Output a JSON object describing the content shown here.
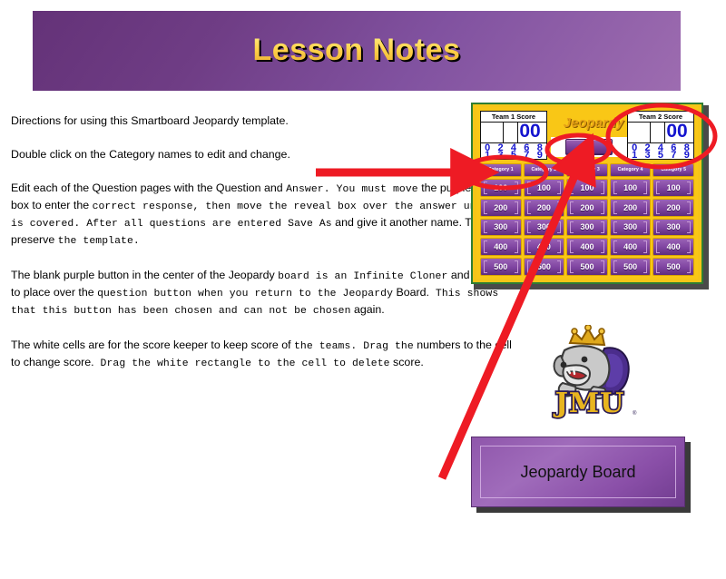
{
  "slide": {
    "title": "Lesson Notes"
  },
  "notes": {
    "paragraphs": [
      {
        "id": "directions",
        "runs": [
          {
            "text": "Directions for using this Smartboard Jeopardy template.",
            "style": "sans"
          }
        ]
      },
      {
        "id": "double-click",
        "runs": [
          {
            "text": "Double click on the Category names to edit and change.",
            "style": "sans"
          }
        ]
      },
      {
        "id": "edit-questions",
        "runs": [
          {
            "text": "Edit each of the Question pages with the Question and ",
            "style": "sans"
          },
          {
            "text": "Answer.   You must move",
            "style": "mono"
          },
          {
            "text": " the purple reveal box to enter the ",
            "style": "sans"
          },
          {
            "text": " correct response, then move the reveal box over the ",
            "style": "mono"
          },
          {
            "text": " answer until it is covered. After all questions are entered ",
            "style": "mono"
          },
          {
            "text": " Save As",
            "style": "mono"
          },
          {
            "text": " and give it another name. This helps preserve ",
            "style": "sans"
          },
          {
            "text": " the template.",
            "style": "mono"
          }
        ]
      },
      {
        "id": "infinite-cloner",
        "runs": [
          {
            "text": "The blank purple button in the center of the Jeopardy ",
            "style": "sans"
          },
          {
            "text": "  board is an Infinite Cloner",
            "style": "mono"
          },
          {
            "text": " and is used to place over the ",
            "style": "sans"
          },
          {
            "text": " question button when you return to the Jeopardy",
            "style": "mono"
          },
          {
            "text": " Board.",
            "style": "sans"
          },
          {
            "text": "  This shows that this button has been chosen and can not ",
            "style": "mono"
          },
          {
            "text": "  be chosen",
            "style": "mono"
          },
          {
            "text": " again.",
            "style": "sans"
          }
        ]
      },
      {
        "id": "white-cells",
        "runs": [
          {
            "text": "The white cells are for the score keeper to keep score of ",
            "style": "sans"
          },
          {
            "text": "  the teams.   Drag the",
            "style": "mono"
          },
          {
            "text": " numbers to the cell to change score.",
            "style": "sans"
          },
          {
            "text": "   Drag the white rectangle to the cell to delete",
            "style": "mono"
          },
          {
            "text": " score.",
            "style": "sans"
          }
        ]
      }
    ]
  },
  "board": {
    "game_title": "Jeopardy",
    "teams": [
      {
        "label": "Team 1 Score",
        "score": "00"
      },
      {
        "label": "Team 2 Score",
        "score": "00"
      }
    ],
    "digit_row_top": [
      "0",
      "2",
      "4",
      "6",
      "8"
    ],
    "digit_row_bottom": [
      "1",
      "3",
      "5",
      "7",
      "9"
    ],
    "cloner_button_label": "",
    "categories": [
      "Category 1",
      "Category 2",
      "Category 3",
      "Category 4",
      "Category 5"
    ],
    "values": [
      "100",
      "200",
      "300",
      "400",
      "500"
    ],
    "colors": {
      "frame": "#f9c716",
      "tile": "#7e43a0",
      "tile_border": "#d9a400",
      "score_text": "#1414cf",
      "title_text": "#e8a317"
    }
  },
  "logo": {
    "name": "jmu-duke-dog-logo",
    "wordmark": "JMU",
    "trademark": "®"
  },
  "jeopardy_board_button": {
    "label": "Jeopardy Board"
  },
  "annotations": {
    "color": "#ee1b24",
    "items": [
      {
        "name": "ellipse-category-1",
        "shape": "ellipse"
      },
      {
        "name": "ellipse-infinite-cloner",
        "shape": "ellipse"
      },
      {
        "name": "ellipse-team-2-score",
        "shape": "ellipse"
      },
      {
        "name": "arrow-to-category-1",
        "shape": "arrow-right"
      },
      {
        "name": "arrow-to-infinite-cloner",
        "shape": "arrow-diagonal"
      }
    ]
  }
}
